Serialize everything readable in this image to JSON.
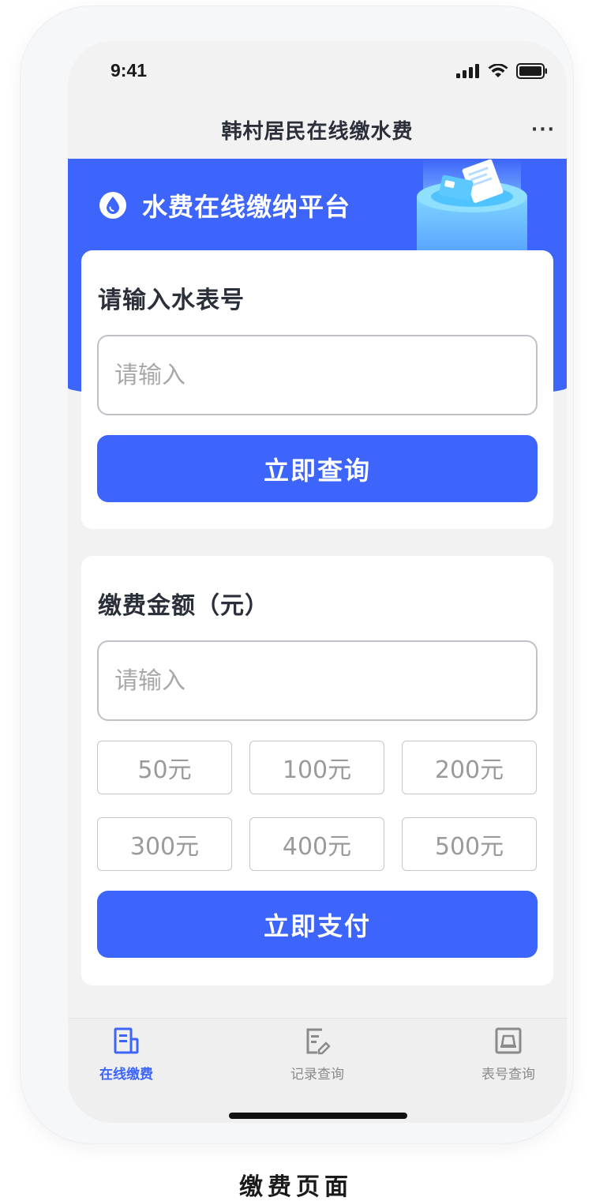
{
  "status_bar": {
    "time": "9:41"
  },
  "nav": {
    "title": "韩村居民在线缴水费",
    "more": "···"
  },
  "banner": {
    "title": "水费在线缴纳平台"
  },
  "meter_card": {
    "title": "请输入水表号",
    "placeholder": "请输入",
    "button_label": "立即查询"
  },
  "payment_card": {
    "title": "缴费金额（元）",
    "placeholder": "请输入",
    "amounts": [
      "50元",
      "100元",
      "200元",
      "300元",
      "400元",
      "500元"
    ],
    "button_label": "立即支付"
  },
  "tab_bar": {
    "tabs": [
      {
        "label": "在线缴费",
        "icon": "bill-icon",
        "active": true
      },
      {
        "label": "记录查询",
        "icon": "record-edit-icon",
        "active": false
      },
      {
        "label": "表号查询",
        "icon": "meter-icon",
        "active": false
      }
    ]
  },
  "caption": "缴费页面",
  "colors": {
    "primary": "#3d64fb",
    "text_dark": "#2b2f3a",
    "placeholder": "#a8a8a8",
    "inactive_tab": "#8a8a8a"
  }
}
